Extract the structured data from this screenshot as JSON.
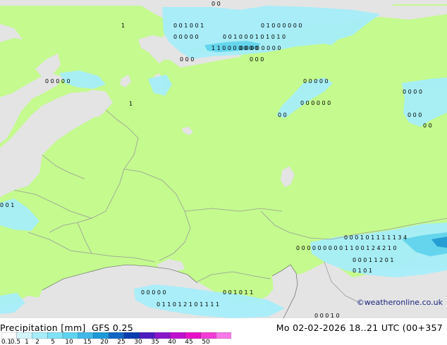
{
  "map": {
    "colors": {
      "sea": "#e4e4e4",
      "land": "#c4fa8e",
      "border": "#9a9a9a",
      "coast": "#555555",
      "precip_light": "#a6eefa",
      "precip_medium": "#5fd4f2",
      "precip_strong": "#1e9ad8"
    },
    "grid_values": [
      {
        "row": 1,
        "text": "0   0"
      },
      {
        "row": 2,
        "text": "1"
      },
      {
        "row": 3,
        "text": "0   0   0   0   0"
      },
      {
        "row": 4,
        "text": "0   0   1   0   0   1"
      },
      {
        "row": 5,
        "text": "0   0   0"
      },
      {
        "row": 6,
        "text": "0   1   0   0   0   0   0   0"
      },
      {
        "row": 7,
        "text": "0   0   1   0   0   0   1   0   1   0   1   0"
      },
      {
        "row": 8,
        "text": "0   0   0   0   0   0   0   0"
      },
      {
        "row": 9,
        "text": "1   1   0   0   0   0   0   0   0"
      },
      {
        "row": 10,
        "text": "0   0   0"
      },
      {
        "row": 11,
        "text": "0   0   0   0   0"
      },
      {
        "row": 12,
        "text": "0   0   0   0   0"
      },
      {
        "row": 13,
        "text": "0   0   0   0"
      },
      {
        "row": 14,
        "text": "1"
      },
      {
        "row": 15,
        "text": "0   0   0   0   0   0"
      },
      {
        "row": 16,
        "text": "0   0"
      },
      {
        "row": 17,
        "text": "0   0   0"
      },
      {
        "row": 18,
        "text": "0   0"
      },
      {
        "row": 19,
        "text": "0   0   0   0   0"
      },
      {
        "row": 20,
        "text": "0   0   1"
      },
      {
        "row": 21,
        "text": "0   0   0   1   0   1   1   1   1   1   3   4"
      },
      {
        "row": 22,
        "text": "0   0   0   0   0   0   0   0   0   1   1   0   0   1   2   4   2   1   0"
      },
      {
        "row": 23,
        "text": "0   0   0   1   1   2   0   1"
      },
      {
        "row": 24,
        "text": "0   1   0   1"
      },
      {
        "row": 25,
        "text": "0   0   1   0   1   1"
      },
      {
        "row": 26,
        "text": "0   1   1   0   1   2   1   0   1   1   1   1"
      },
      {
        "row": 27,
        "text": "0   0   0   1   0"
      }
    ]
  },
  "legend": {
    "title": "Precipitation [mm]",
    "model": "GFS 0.25",
    "ticks": [
      "0.1",
      "0.5",
      "1",
      "2",
      "5",
      "10",
      "15",
      "20",
      "25",
      "30",
      "35",
      "40",
      "45",
      "50"
    ],
    "colors": [
      "#ffffff",
      "#d2f6fc",
      "#a6eefa",
      "#80e2f6",
      "#5fd4f2",
      "#40b8ea",
      "#1e9ad8",
      "#1266c4",
      "#0a3db0",
      "#4c1cc0",
      "#8a16cc",
      "#c010d0",
      "#e810c8",
      "#f23cd8",
      "#fa78e8"
    ]
  },
  "datetime": "Mo 02-02-2026 18..21 UTC (00+357",
  "credit": "©weatheronline.co.uk"
}
